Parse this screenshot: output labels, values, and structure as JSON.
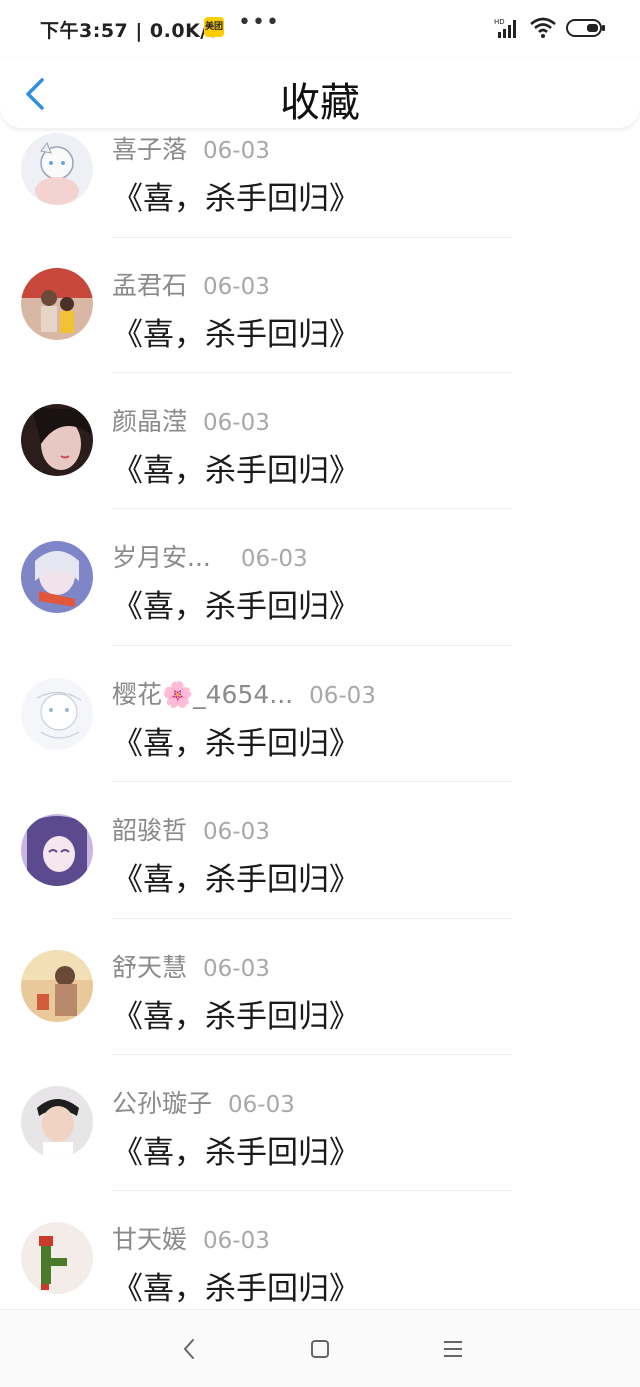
{
  "status_bar": {
    "time_speed": "下午3:57 | 0.0K/s",
    "app_badge": "美团",
    "more_dots": "•••"
  },
  "header": {
    "title": "收藏"
  },
  "favorites": [
    {
      "name": "喜子落",
      "date": "06-03",
      "message": "《喜，杀手回归》"
    },
    {
      "name": "孟君石",
      "date": "06-03",
      "message": "《喜，杀手回归》"
    },
    {
      "name": "颜晶滢",
      "date": "06-03",
      "message": "《喜，杀手回归》"
    },
    {
      "name": "岁月安...",
      "date": "06-03",
      "message": "《喜，杀手回归》"
    },
    {
      "name": "樱花🌸_4654...",
      "date": "06-03",
      "message": "《喜，杀手回归》"
    },
    {
      "name": "韶骏哲",
      "date": "06-03",
      "message": "《喜，杀手回归》"
    },
    {
      "name": "舒天慧",
      "date": "06-03",
      "message": "《喜，杀手回归》"
    },
    {
      "name": "公孙璇子",
      "date": "06-03",
      "message": "《喜，杀手回归》"
    },
    {
      "name": "甘天媛",
      "date": "06-03",
      "message": "《喜，杀手回归》"
    }
  ],
  "colors": {
    "accent": "#2f8de4",
    "name_text": "#8a8a8a",
    "message_text": "#1a1a1a"
  },
  "icons": {
    "back": "chevron-left-icon",
    "nav_back": "nav-back-icon",
    "nav_home": "nav-home-icon",
    "nav_menu": "nav-menu-icon"
  }
}
